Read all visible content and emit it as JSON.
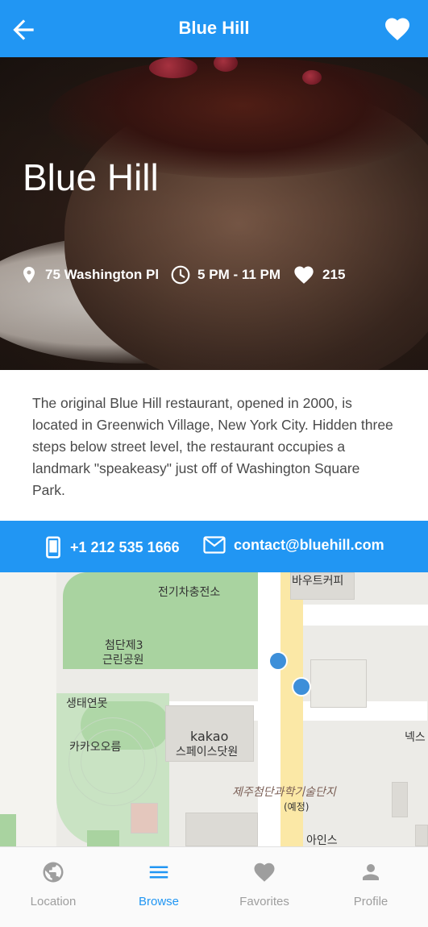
{
  "header": {
    "title": "Blue Hill",
    "back_icon": "arrow-left-icon",
    "favorite_icon": "heart-icon"
  },
  "hero": {
    "name": "Blue Hill",
    "address": "75 Washington Pl",
    "hours": "5 PM - 11 PM",
    "likes": "215"
  },
  "description": "The original Blue Hill restaurant, opened in 2000, is located in Greenwich Village, New York City. Hidden three steps below street level, the restaurant occupies a landmark \"speakeasy\" just off of Washington Square Park.",
  "contact": {
    "phone": "+1 212 535 1666",
    "email": "contact@bluehill.com"
  },
  "map": {
    "labels": {
      "charging": "전기차충전소",
      "bout_coffee": "바우트커피",
      "park_1": "첨단제3",
      "park_2": "근린공원",
      "pond": "생태연못",
      "kakao_oreum": "카카오오름",
      "kakao": "kakao",
      "space_dot_one": "스페이스닷원",
      "tech_complex": "제주첨단과학기술단지",
      "planned": "(예정)",
      "nex": "넥스",
      "ains": "아인스"
    }
  },
  "nav": {
    "tabs": [
      {
        "label": "Location",
        "icon": "globe-icon"
      },
      {
        "label": "Browse",
        "icon": "menu-icon"
      },
      {
        "label": "Favorites",
        "icon": "heart-icon"
      },
      {
        "label": "Profile",
        "icon": "person-icon"
      }
    ],
    "active_color": "#2196f3",
    "inactive_color": "#9e9e9e"
  },
  "colors": {
    "primary": "#2196f3"
  }
}
